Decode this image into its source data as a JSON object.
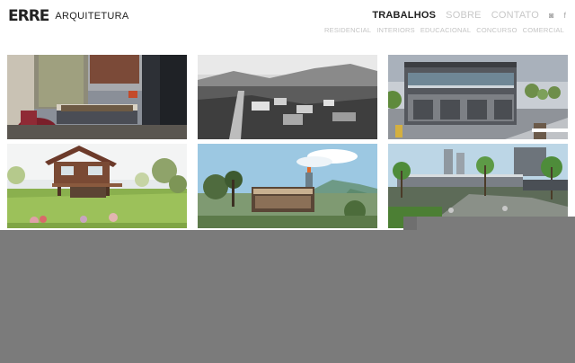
{
  "brand": {
    "mark": "ERRE",
    "name": "ARQUITETURA"
  },
  "nav": {
    "main": [
      "TRABALHOS",
      "SOBRE",
      "CONTATO"
    ],
    "social": [
      "instagram-icon",
      "facebook-icon"
    ],
    "social_glyphs": [
      "◙",
      "f"
    ],
    "categories": [
      "RESIDENCIAL",
      "INTERIORS",
      "EDUCACIONAL",
      "CONCURSO",
      "COMERCIAL"
    ]
  },
  "projects": [
    {
      "id": "interior-bedroom"
    },
    {
      "id": "aerial-town"
    },
    {
      "id": "commercial-building"
    },
    {
      "id": "wooden-house"
    },
    {
      "id": "pavilion-mountain"
    },
    {
      "id": "urban-plaza"
    }
  ]
}
